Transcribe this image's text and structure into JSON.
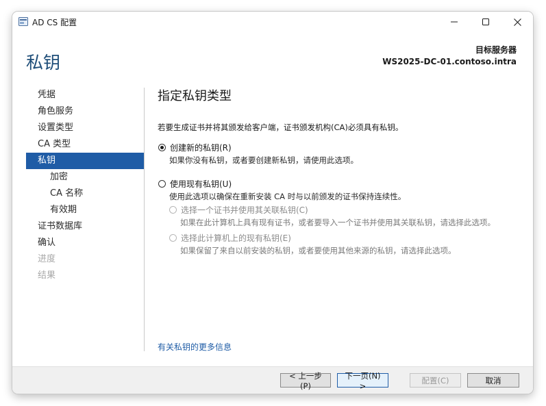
{
  "window": {
    "title": "AD CS 配置",
    "heading": "私钥",
    "target_label": "目标服务器",
    "target_server": "WS2025-DC-01.contoso.intra"
  },
  "nav": {
    "items": [
      {
        "label": "凭据",
        "state": "normal",
        "level": 0
      },
      {
        "label": "角色服务",
        "state": "normal",
        "level": 0
      },
      {
        "label": "设置类型",
        "state": "normal",
        "level": 0
      },
      {
        "label": "CA 类型",
        "state": "normal",
        "level": 0
      },
      {
        "label": "私钥",
        "state": "active",
        "level": 0
      },
      {
        "label": "加密",
        "state": "normal",
        "level": 1
      },
      {
        "label": "CA 名称",
        "state": "normal",
        "level": 1
      },
      {
        "label": "有效期",
        "state": "normal",
        "level": 1
      },
      {
        "label": "证书数据库",
        "state": "normal",
        "level": 0
      },
      {
        "label": "确认",
        "state": "normal",
        "level": 0
      },
      {
        "label": "进度",
        "state": "disabled",
        "level": 0
      },
      {
        "label": "结果",
        "state": "disabled",
        "level": 0
      }
    ]
  },
  "content": {
    "section_title": "指定私钥类型",
    "intro": "若要生成证书并将其颁发给客户端，证书颁发机构(CA)必须具有私钥。",
    "option_new": {
      "label": "创建新的私钥(R)",
      "description": "如果你没有私钥，或者要创建新私钥，请使用此选项。",
      "checked": true
    },
    "option_existing": {
      "label": "使用现有私钥(U)",
      "description": "使用此选项以确保在重新安装 CA 时与以前颁发的证书保持连续性。",
      "checked": false
    },
    "sub_option_cert": {
      "label": "选择一个证书并使用其关联私钥(C)",
      "description": "如果在此计算机上具有现有证书，或者要导入一个证书并使用其关联私钥，请选择此选项。"
    },
    "sub_option_key": {
      "label": "选择此计算机上的现有私钥(E)",
      "description": "如果保留了来自以前安装的私钥，或者要使用其他来源的私钥，请选择此选项。"
    },
    "more_link": "有关私钥的更多信息"
  },
  "footer": {
    "prev_label": "< 上一步(P)",
    "next_label": "下一页(N) >",
    "configure_label": "配置(C)",
    "cancel_label": "取消"
  },
  "colors": {
    "accent": "#1f5ca6",
    "heading": "#1f4e79"
  }
}
